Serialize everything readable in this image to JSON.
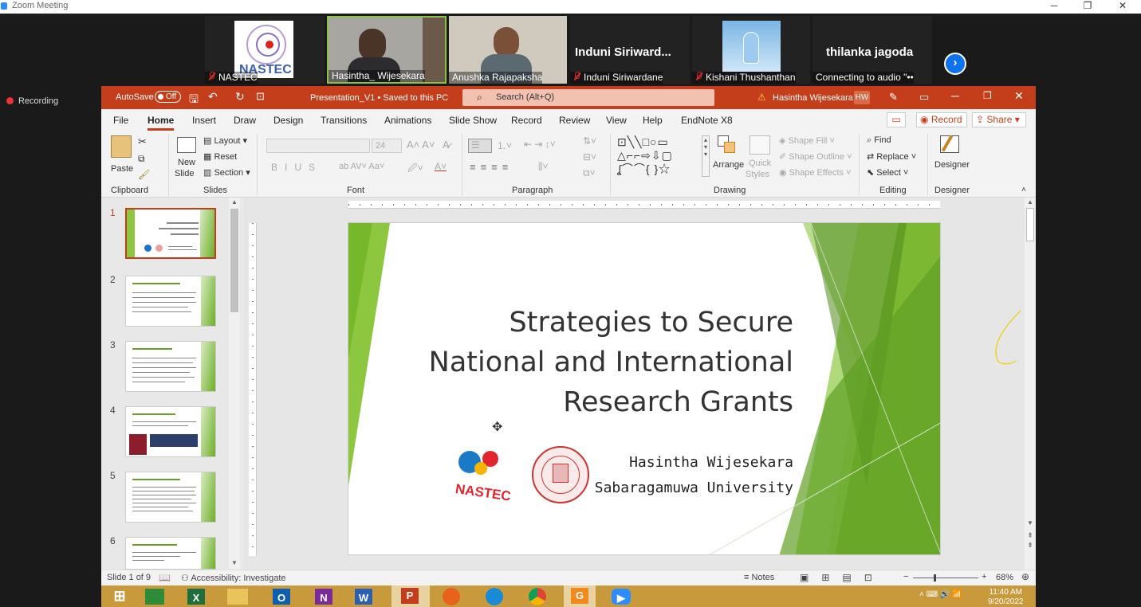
{
  "zoom": {
    "window_title": "Zoom Meeting",
    "recording_label": "Recording",
    "participants": [
      {
        "name": "NASTEC",
        "logo_text": "NASTEC"
      },
      {
        "name": "Hasintha_ Wijesekara"
      },
      {
        "name": "Anushka Rajapaksha"
      },
      {
        "name": "Induni Siriwardane",
        "big_name": "Induni Siriward..."
      },
      {
        "name": "Kishani Thushanthan"
      },
      {
        "name": "Connecting to audio",
        "big_name": "thilanka jagoda"
      }
    ],
    "window_controls": [
      "─",
      "❐",
      "✕"
    ]
  },
  "ppt": {
    "autosave_label": "AutoSave",
    "autosave_state": "Off",
    "doc_title": "Presentation_V1 • Saved to this PC",
    "search_placeholder": "Search (Alt+Q)",
    "user_name": "Hasintha Wijesekara",
    "user_initials": "HW",
    "menu": [
      "File",
      "Home",
      "Insert",
      "Draw",
      "Design",
      "Transitions",
      "Animations",
      "Slide Show",
      "Record",
      "Review",
      "View",
      "Help",
      "EndNote X8"
    ],
    "record_btn": "Record",
    "share_btn": "Share",
    "ribbon": {
      "paste": "Paste",
      "new_slide_1": "New",
      "new_slide_2": "Slide",
      "layout": "Layout",
      "reset": "Reset",
      "section": "Section",
      "font_size": "24",
      "arrange": "Arrange",
      "quick_styles_1": "Quick",
      "quick_styles_2": "Styles",
      "shape_fill": "Shape Fill",
      "shape_outline": "Shape Outline",
      "shape_effects": "Shape Effects",
      "find": "Find",
      "replace": "Replace",
      "select": "Select",
      "designer": "Designer",
      "groups": [
        "Clipboard",
        "Slides",
        "Font",
        "Paragraph",
        "Drawing",
        "Editing",
        "Designer"
      ]
    },
    "slides": [
      "1",
      "2",
      "3",
      "4",
      "5",
      "6"
    ],
    "slide": {
      "title_lines": [
        "Strategies to Secure",
        "National and International",
        "Research Grants"
      ],
      "author": "Hasintha Wijesekara",
      "affiliation": "Sabaragamuwa University",
      "page_number": "1",
      "logo_text": "NASTEC"
    },
    "status": {
      "slide_of": "Slide 1 of 9",
      "accessibility": "Accessibility: Investigate",
      "notes": "Notes",
      "zoom": "68%"
    }
  },
  "taskbar": {
    "time": "11:40 AM",
    "date": "9/20/2022"
  },
  "colors": {
    "ppt_red": "#c43e1c",
    "slide_green": "#8dc63f",
    "zoom_blue": "#0e72ed"
  }
}
